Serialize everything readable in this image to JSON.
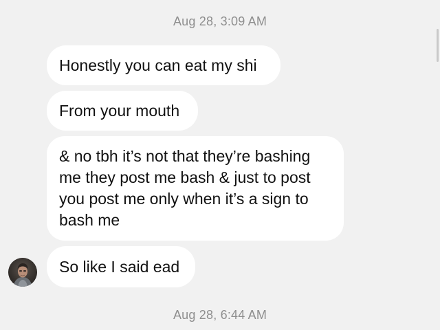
{
  "thread": {
    "timestamp_top": "Aug 28, 3:09 AM",
    "timestamp_bottom": "Aug 28, 6:44 AM",
    "messages": [
      {
        "text": "Honestly you can eat my shi"
      },
      {
        "text": "From your mouth"
      },
      {
        "text": "& no tbh it’s not that they’re bashing me they post me bash & just to post you post me only when it’s a sign to bash me"
      },
      {
        "text": "So like I said ead"
      }
    ],
    "avatar": {
      "icon": "user-avatar-photo"
    }
  }
}
